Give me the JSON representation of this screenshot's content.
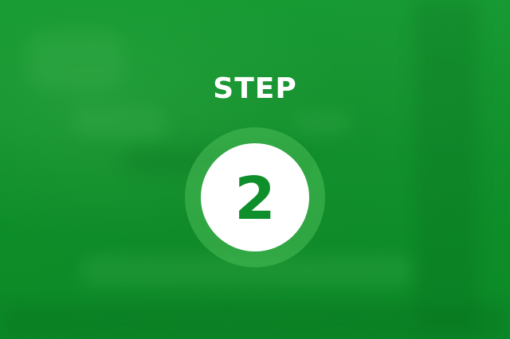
{
  "step": {
    "title": "STEP",
    "number": "2"
  },
  "colors": {
    "background": "#0f8f2b",
    "text": "#ffffff",
    "badge": "#ffffff",
    "badge_ring": "#4abe58",
    "number": "#0f8f2b"
  }
}
